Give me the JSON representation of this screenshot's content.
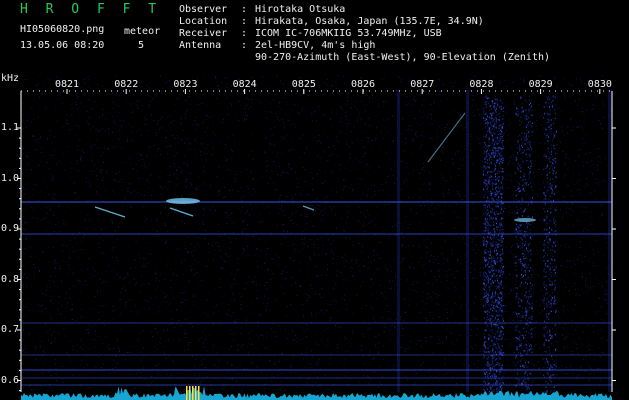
{
  "header": {
    "brand": "H R O F F T",
    "filename": "HI05060820.png",
    "datetime": "13.05.06 08:20",
    "meteor_label": "meteor",
    "meteor_count": "5"
  },
  "info": {
    "observer": {
      "key": "Observer",
      "value": "Hirotaka Otsuka"
    },
    "location": {
      "key": "Location",
      "value": "Hirakata, Osaka, Japan (135.7E, 34.9N)"
    },
    "receiver": {
      "key": "Receiver",
      "value": "ICOM IC-706MKIIG 53.749MHz, USB"
    },
    "antenna": {
      "key": "Antenna",
      "value": "2el-HB9CV, 4m's high",
      "value2": "90-270-Azimuth (East-West), 90-Elevation (Zenith)"
    }
  },
  "axis": {
    "unit": "kHz",
    "time_ticks": [
      "0821",
      "0822",
      "0823",
      "0824",
      "0825",
      "0826",
      "0827",
      "0828",
      "0829",
      "0830"
    ],
    "freq_ticks": [
      "1.1",
      "1.0",
      "0.9",
      "0.8",
      "0.7",
      "0.6"
    ]
  },
  "colors": {
    "brand": "#28c85a",
    "text": "#f0f0f0",
    "background": "#000000",
    "noise": "#1a2a9a",
    "carrier": "#3c5cff",
    "echo": "#7fd8ff",
    "baseline": "#18b8e8",
    "marker": "#ffe040"
  }
}
